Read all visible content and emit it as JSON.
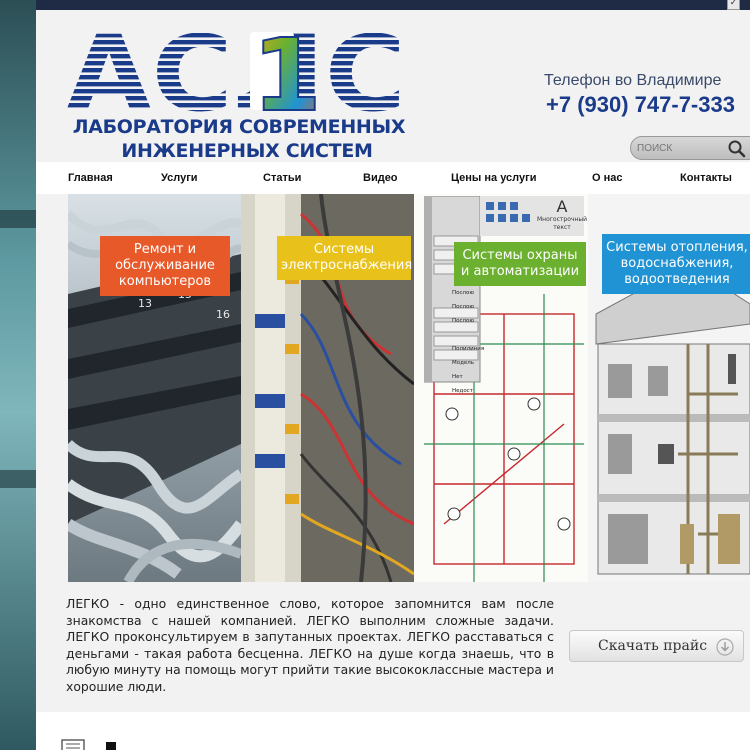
{
  "logo": {
    "text": "АСЛС",
    "number": "1",
    "line1": "ЛАБОРАТОРИЯ СОВРЕМЕННЫХ",
    "line2": "ИНЖЕНЕРНЫХ СИСТЕМ"
  },
  "header": {
    "phone_label": "Телефон во Владимире",
    "phone_number": "+7 (930) 747-7-333"
  },
  "search": {
    "placeholder": "ПОИСК",
    "icon": "search-icon"
  },
  "nav": {
    "items": [
      {
        "label": "Главная"
      },
      {
        "label": "Услуги"
      },
      {
        "label": "Статьи"
      },
      {
        "label": "Видео"
      },
      {
        "label": "Цены на услуги"
      },
      {
        "label": "О нас"
      },
      {
        "label": "Контакты"
      }
    ]
  },
  "banner": {
    "panels": [
      {
        "label": "Ремонт и обслуживание компьютеров",
        "color": "#e8592a"
      },
      {
        "label": "Системы электроснабжения",
        "color": "#e8c21a"
      },
      {
        "label": "Системы охраны и автоматизации",
        "color": "#6bb02e"
      },
      {
        "label": "Системы отопления, водоснабжения, водоотведения",
        "color": "#1f93d4"
      }
    ],
    "cad_palette": {
      "letter": "A",
      "caption": "Многострочный текст",
      "rows": [
        "Послою",
        "Послою",
        "Послою",
        "Полилиния",
        "Модель",
        "Нет",
        "Недост"
      ]
    }
  },
  "intro": {
    "text": "ЛЕГКО - одно единственное слово, которое запомнится вам после знакомства с нашей компанией. ЛЕГКО выполним сложные задачи. ЛЕГКО проконсультируем в запутанных проектах. ЛЕГКО расставаться с деньгами - такая работа бесценна. ЛЕГКО на душе когда знаешь, что в любую минуту на помощь могут прийти такие высококлассные мастера и хорошие люди."
  },
  "price_button": {
    "label": "Скачать прайс",
    "icon": "download-arrow-icon"
  },
  "colors": {
    "brand_blue": "#1a3a8a",
    "accent_green": "#5aa02c",
    "top_bar": "#1f2a44"
  }
}
